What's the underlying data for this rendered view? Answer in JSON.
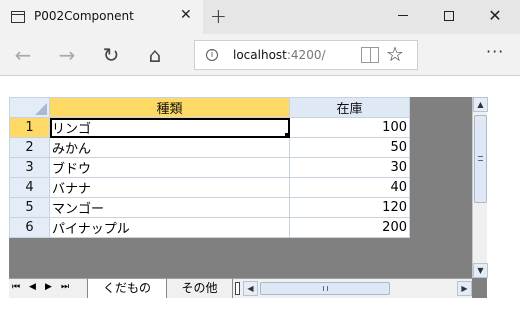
{
  "browser": {
    "tab_title": "P002Component",
    "tab_close": "✕",
    "new_tab": "+",
    "url_host": "localhost",
    "url_rest": ":4200/",
    "info_glyph": "i",
    "icons": [
      "window-icon",
      "back-arrow-icon",
      "forward-arrow-icon",
      "refresh-icon",
      "home-icon",
      "info-icon",
      "reading-view-icon",
      "favorite-star-icon",
      "more-icon"
    ]
  },
  "window": {
    "minimize": "",
    "maximize": "",
    "close": "✕"
  },
  "nav": {
    "back": "←",
    "forward": "→",
    "refresh": "↻",
    "home": "⌂",
    "favorite": "☆",
    "more": "···"
  },
  "spreadsheet": {
    "columns": [
      "種類",
      "在庫"
    ],
    "selected_column": 0,
    "selected_row": 0,
    "rows": [
      {
        "index": "1",
        "kind": "リンゴ",
        "stock": "100"
      },
      {
        "index": "2",
        "kind": "みかん",
        "stock": "50"
      },
      {
        "index": "3",
        "kind": "ブドウ",
        "stock": "30"
      },
      {
        "index": "4",
        "kind": "バナナ",
        "stock": "40"
      },
      {
        "index": "5",
        "kind": "マンゴー",
        "stock": "120"
      },
      {
        "index": "6",
        "kind": "パイナップル",
        "stock": "200"
      }
    ],
    "sheet_tabs": [
      "くだもの",
      "その他"
    ],
    "active_sheet": "くだもの",
    "nav_buttons": [
      "⏮",
      "◀",
      "▶",
      "⏭"
    ],
    "scroll_up": "▲",
    "scroll_down": "▼",
    "scroll_left": "◀",
    "scroll_right": "▶",
    "colors": {
      "selection_header": "#ffd966",
      "header": "#dfe8f5",
      "background": "#808080"
    }
  }
}
